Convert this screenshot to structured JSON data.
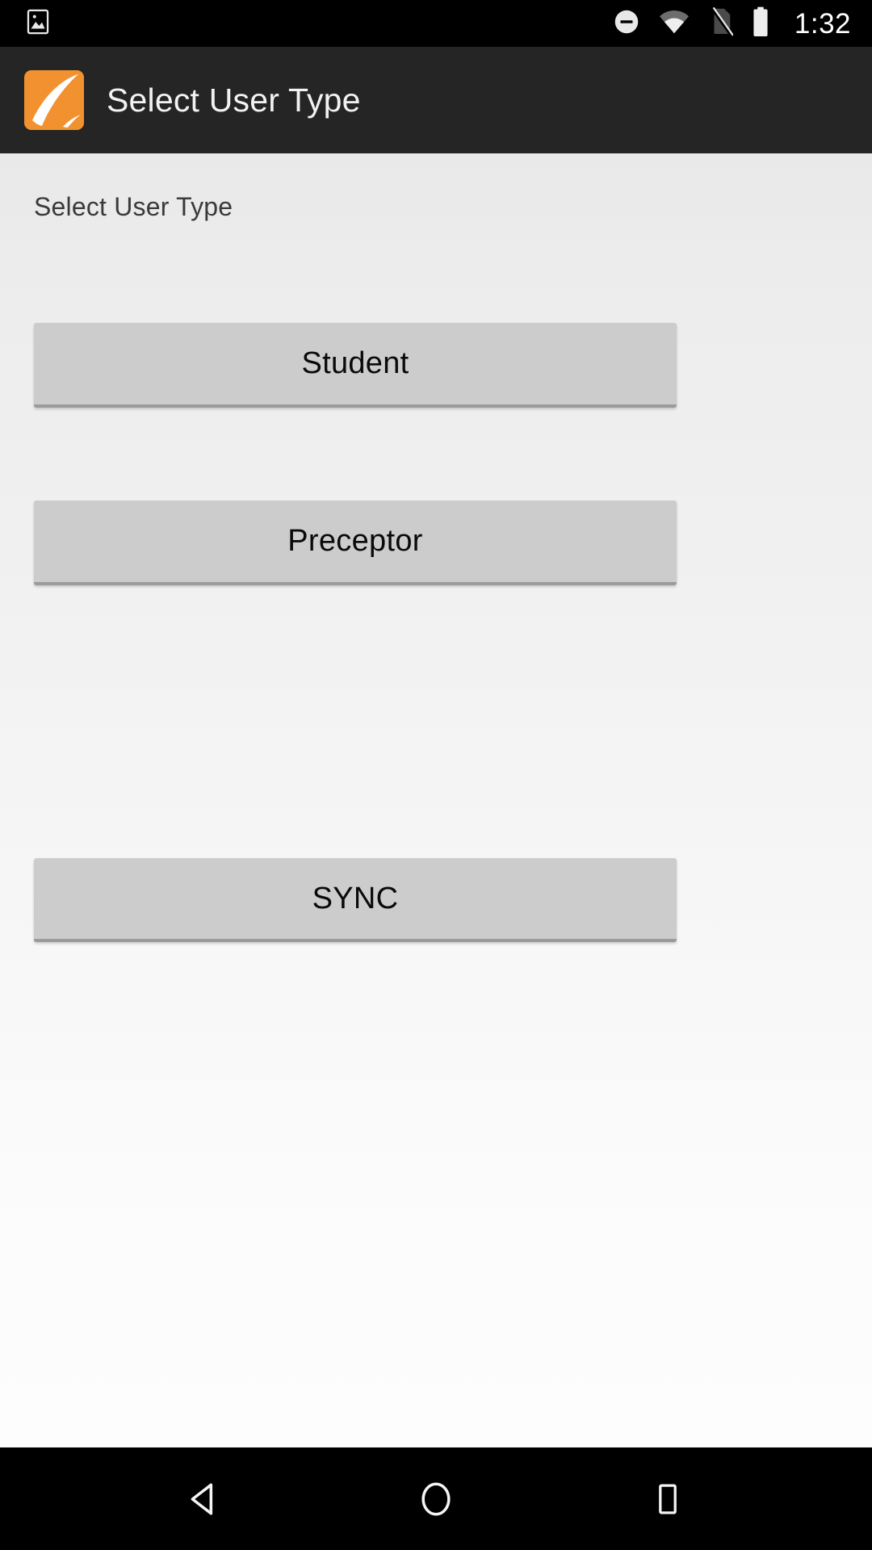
{
  "status_bar": {
    "time": "1:32",
    "icons": {
      "notification_left": "image-icon",
      "dnd": "do-not-disturb-icon",
      "wifi": "wifi-icon",
      "sim": "no-sim-card-icon",
      "battery": "battery-full-icon"
    }
  },
  "app_bar": {
    "title": "Select User Type",
    "logo": "app-logo-leaf-icon",
    "logo_color": "#F29130",
    "background_color": "#252525",
    "title_color": "#F2F2F2"
  },
  "content": {
    "section_label": "Select User Type",
    "background_top_color": "#E9E9E9",
    "background_bottom_color": "#FDFDFD",
    "buttons": [
      {
        "label": "Student",
        "name": "student-button"
      },
      {
        "label": "Preceptor",
        "name": "preceptor-button"
      },
      {
        "label": "SYNC",
        "name": "sync-button"
      }
    ],
    "button_color": "#CCCCCC",
    "button_text_color": "#0A0A0A"
  },
  "nav_bar": {
    "back": "back-triangle-icon",
    "home": "home-circle-icon",
    "recents": "recents-square-icon",
    "background_color": "#000000"
  }
}
